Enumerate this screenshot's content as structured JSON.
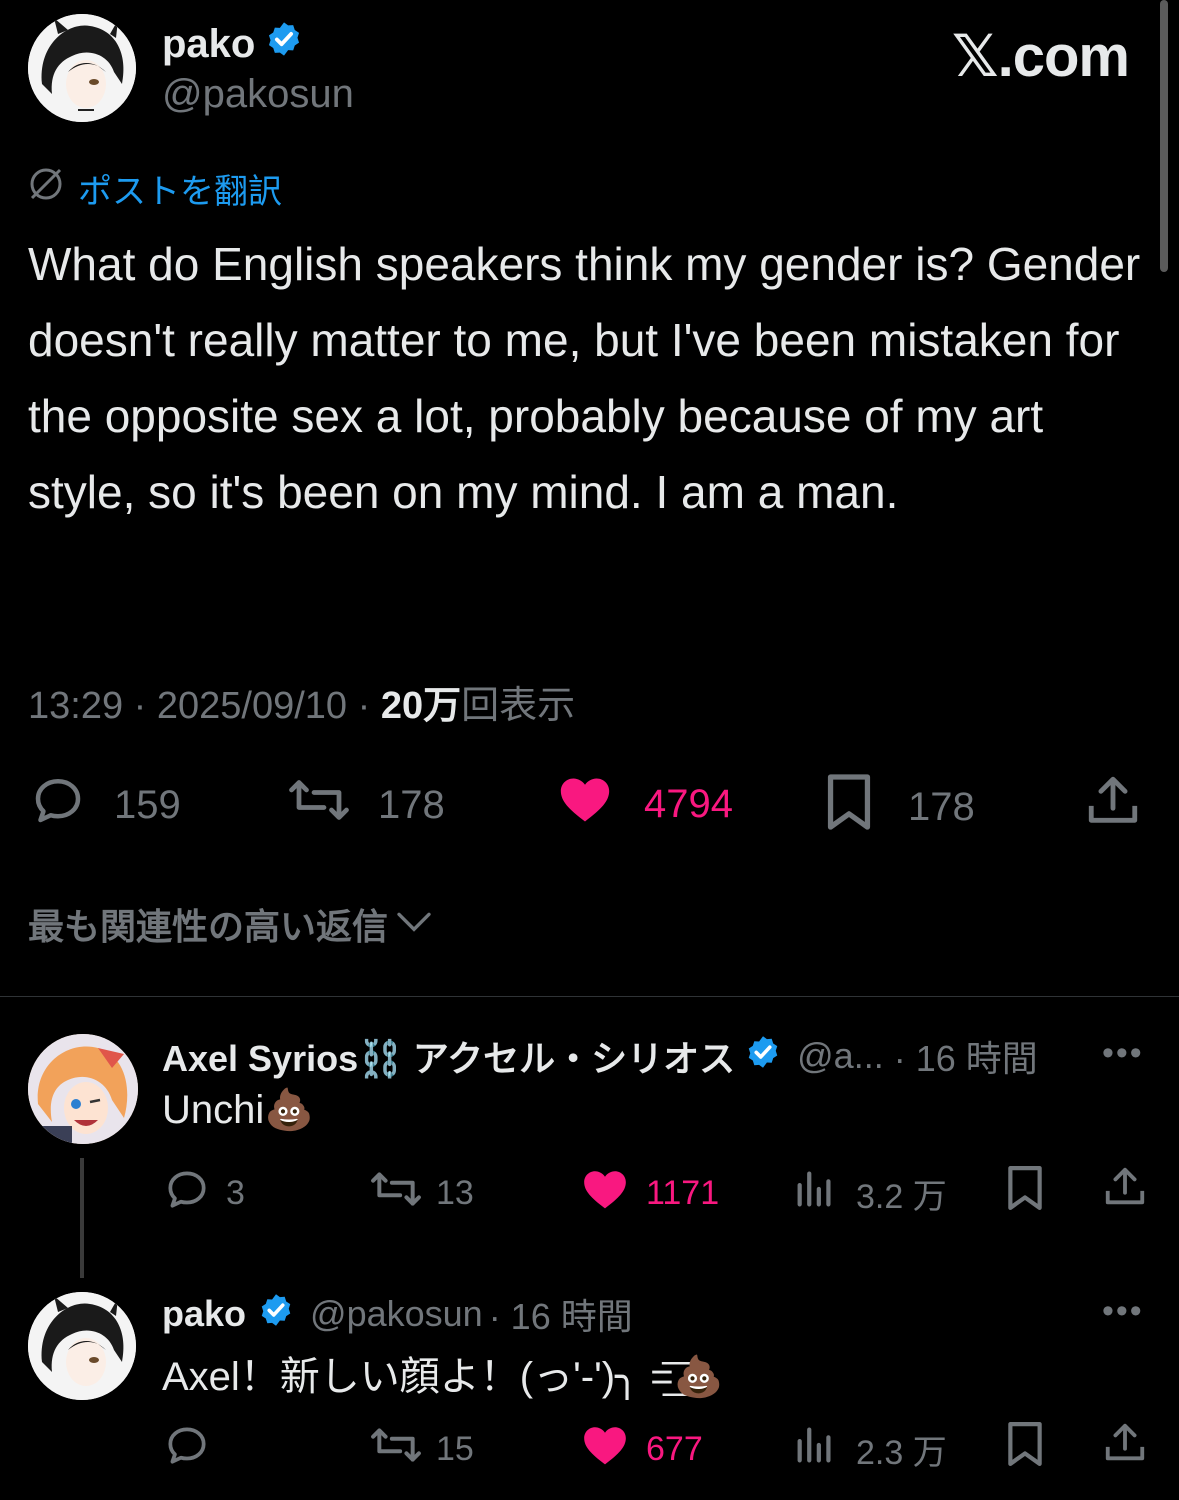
{
  "site": "𝕏.com",
  "post": {
    "author_name": "pako",
    "author_handle": "@pakosun",
    "translate_label": "ポストを翻訳",
    "text": "What do English speakers think my gender is? Gender doesn't really matter to me, but I've been mistaken for the opposite sex a lot, probably because of my art style, so it's been on my mind. I am a man.",
    "time": "13:29",
    "date": "2025/09/10",
    "views_count": "20万",
    "views_label": "回表示",
    "separator": " · ",
    "replies": "159",
    "reposts": "178",
    "likes": "4794",
    "bookmarks": "178"
  },
  "sort_label": "最も関連性の高い返信",
  "replies": [
    {
      "name": "Axel Syrios⛓️ アクセル・シリオス",
      "handle": "@a...",
      "time": "· 16 時間",
      "text": "Unchi💩",
      "replies": "3",
      "reposts": "13",
      "likes": "1171",
      "views": "3.2 万"
    },
    {
      "name": "pako",
      "handle": "@pakosun",
      "time": "· 16 時間",
      "text": "Axel！新しい顔よ！(っ'-')╮ =͟͟͞💩",
      "replies": "",
      "reposts": "15",
      "likes": "677",
      "views": "2.3 万"
    }
  ],
  "colors": {
    "background": "#000000",
    "text": "#e7e9ea",
    "muted": "#71767b",
    "link": "#1d9bf0",
    "like": "#f91880",
    "verified": "#1d9bf0"
  },
  "more_label": "•••"
}
